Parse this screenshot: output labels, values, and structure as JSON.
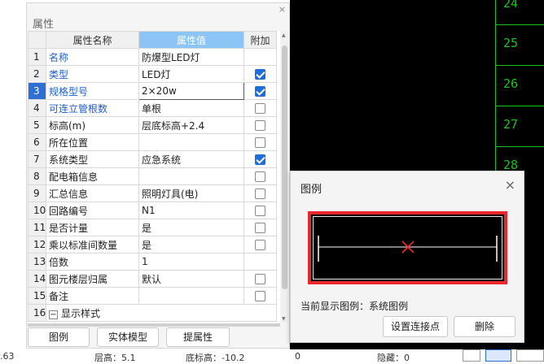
{
  "panel": {
    "title": "属性",
    "close": "×",
    "columns": {
      "num": "",
      "name": "属性名称",
      "value": "属性值",
      "extra": "附加"
    },
    "rows": [
      {
        "num": "1",
        "name": "名称",
        "value": "防爆型LED灯",
        "blue": true,
        "checkbox": null
      },
      {
        "num": "2",
        "name": "类型",
        "value": "LED灯",
        "blue": true,
        "checkbox": true
      },
      {
        "num": "3",
        "name": "规格型号",
        "value": "2×20w",
        "blue": true,
        "checkbox": true,
        "active": true
      },
      {
        "num": "4",
        "name": "可连立管根数",
        "value": "单根",
        "blue": true,
        "checkbox": false
      },
      {
        "num": "5",
        "name": "标高(m)",
        "value": "层底标高+2.4",
        "blue": false,
        "checkbox": false
      },
      {
        "num": "6",
        "name": "所在位置",
        "value": "",
        "blue": false,
        "checkbox": false
      },
      {
        "num": "7",
        "name": "系统类型",
        "value": "应急系统",
        "blue": false,
        "checkbox": true
      },
      {
        "num": "8",
        "name": "配电箱信息",
        "value": "",
        "blue": false,
        "checkbox": false
      },
      {
        "num": "9",
        "name": "汇总信息",
        "value": "照明灯具(电)",
        "blue": false,
        "checkbox": false
      },
      {
        "num": "10",
        "name": "回路编号",
        "value": "N1",
        "blue": false,
        "checkbox": false
      },
      {
        "num": "11",
        "name": "是否计量",
        "value": "是",
        "blue": false,
        "checkbox": false
      },
      {
        "num": "12",
        "name": "乘以标准间数量",
        "value": "是",
        "blue": false,
        "checkbox": false
      },
      {
        "num": "13",
        "name": "倍数",
        "value": "1",
        "blue": false,
        "checkbox": null
      },
      {
        "num": "14",
        "name": "图元楼层归属",
        "value": "默认",
        "blue": false,
        "checkbox": false
      },
      {
        "num": "15",
        "name": "备注",
        "value": "",
        "blue": false,
        "checkbox": false
      },
      {
        "num": "16",
        "name": "显示样式",
        "value": "",
        "blue": false,
        "checkbox": null,
        "group": true
      }
    ],
    "buttons": {
      "legend": "图例",
      "solid_model": "实体模型",
      "extract": "提属性"
    }
  },
  "canvas": {
    "grid_labels": [
      "24",
      "25",
      "26",
      "27",
      "28"
    ],
    "line_color": "#19c41b"
  },
  "legend_dialog": {
    "title": "图例",
    "close": "×",
    "status": "当前显示图例：系统图例",
    "set_point_button": "设置连接点",
    "delete_button": "删除",
    "accent_color": "#e8262b"
  },
  "statusbar": {
    "coord_fragment": ".63",
    "floor_height": "层高：5.1",
    "floor_base": "底标高：-10.2",
    "zero": "0",
    "hidden": "隐藏：0"
  }
}
